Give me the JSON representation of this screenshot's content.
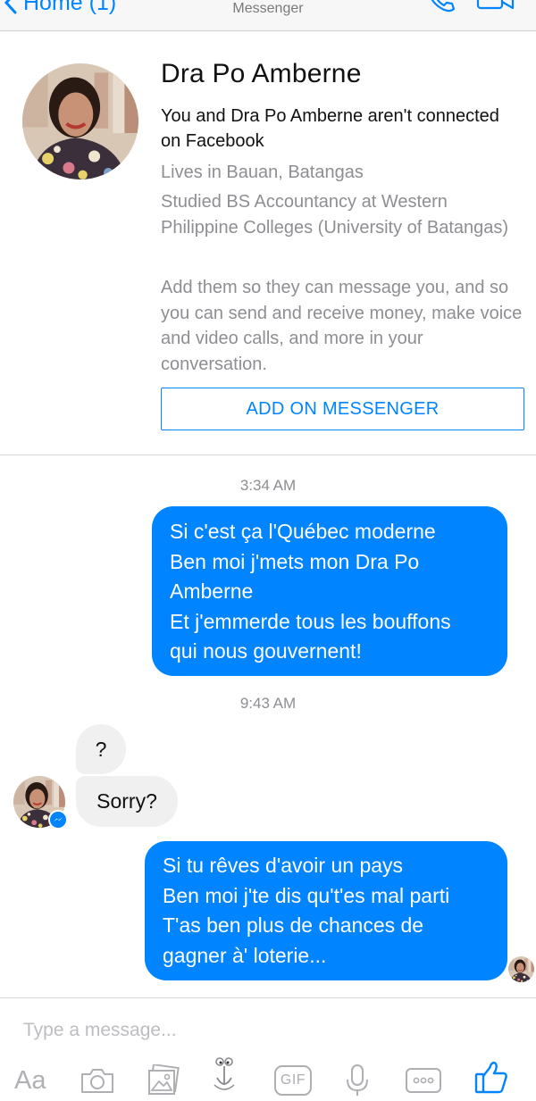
{
  "nav": {
    "back_label": "Home (1)",
    "subtitle": "Messenger",
    "call_icon": "phone-icon",
    "video_icon": "video-camera-icon"
  },
  "profile": {
    "name": "Dra Po Amberne",
    "connection_note": "You and Dra Po Amberne aren't connected on Facebook",
    "lives_in": "Lives in Bauan, Batangas",
    "studied": "Studied BS Accountancy at Western Philippine Colleges (University of Batangas)",
    "add_prompt": "Add them so they can message you, and so you can send and receive money, make voice and video calls, and more in your conversation.",
    "add_button_label": "ADD ON MESSENGER"
  },
  "conversation": {
    "timestamp_1": "3:34 AM",
    "message_1": {
      "line_1": "Si c'est ça l'Québec moderne",
      "line_2": "Ben moi j'mets mon Dra Po",
      "line_3": "Amberne",
      "line_4": "Et j'emmerde tous les bouffons",
      "line_5": "qui nous gouvernent!"
    },
    "timestamp_2": "9:43 AM",
    "message_2": "?",
    "message_3": "Sorry?",
    "message_4": {
      "line_1": "Si tu rêves d'avoir un pays",
      "line_2": "Ben moi j'te dis qu't'es mal parti",
      "line_3": "T'as ben plus de chances de",
      "line_4": "gagner à' loterie..."
    }
  },
  "composer": {
    "placeholder": "Type a message...",
    "text_button_label": "Aa",
    "gif_label": "GIF",
    "tools": [
      "camera-icon",
      "gallery-icon",
      "sticker-icon",
      "gif-icon",
      "microphone-icon",
      "more-icon",
      "like-icon"
    ]
  },
  "colors": {
    "accent": "#0084ff",
    "incoming_bubble": "#f1f0f0",
    "secondary_text": "#8e8e93"
  }
}
